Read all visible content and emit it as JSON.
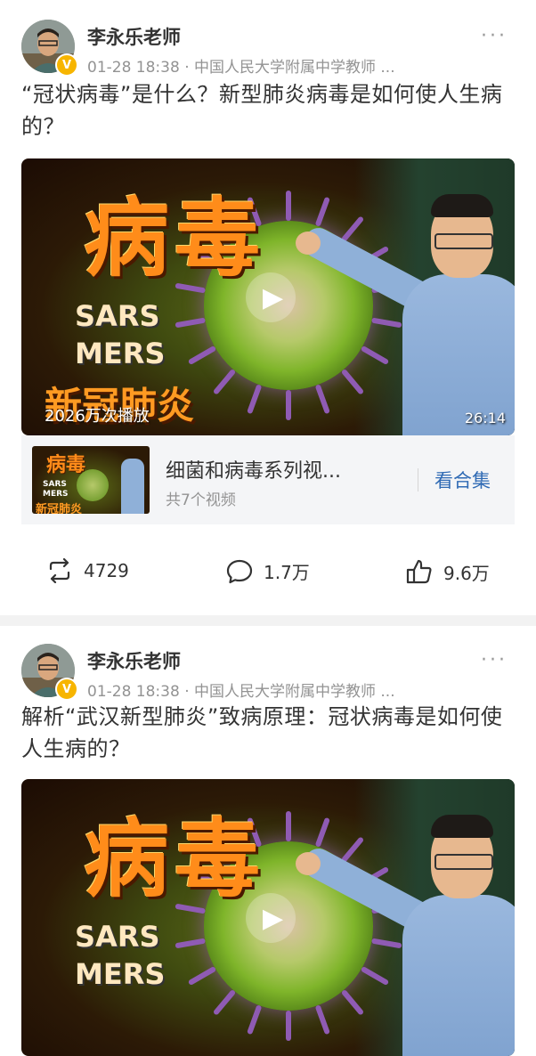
{
  "posts": [
    {
      "author": "李永乐老师",
      "meta": "01-28 18:38 · 中国人民大学附属中学教师 ...",
      "text": "“冠状病毒”是什么？新型肺炎病毒是如何使人生病的？",
      "video": {
        "big_word": "病毒",
        "tags": [
          "SARS",
          "MERS",
          "新冠肺炎"
        ],
        "play_count": "2026万次播放",
        "duration": "26:14"
      },
      "collection": {
        "title": "细菌和病毒系列视...",
        "count": "共7个视频",
        "button": "看合集",
        "thumb_word": "病毒",
        "thumb_tags": [
          "SARS",
          "MERS",
          "新冠肺炎"
        ]
      },
      "actions": {
        "reposts": "4729",
        "comments": "1.7万",
        "likes": "9.6万"
      }
    },
    {
      "author": "李永乐老师",
      "meta": "01-28 18:38 · 中国人民大学附属中学教师 ...",
      "text": "解析“武汉新型肺炎”致病原理：冠状病毒是如何使人生病的？",
      "video": {
        "big_word": "病毒",
        "tags": [
          "SARS",
          "MERS"
        ]
      }
    }
  ],
  "icons": {
    "verified": "verified-badge-icon",
    "more": "more-options-icon",
    "play": "play-icon",
    "repost": "repost-icon",
    "comment": "comment-icon",
    "like": "like-icon"
  },
  "colors": {
    "accent_link": "#2f6ab4",
    "verified": "#f7b500",
    "separator": "#f2f2f2",
    "meta_text": "#939393"
  }
}
